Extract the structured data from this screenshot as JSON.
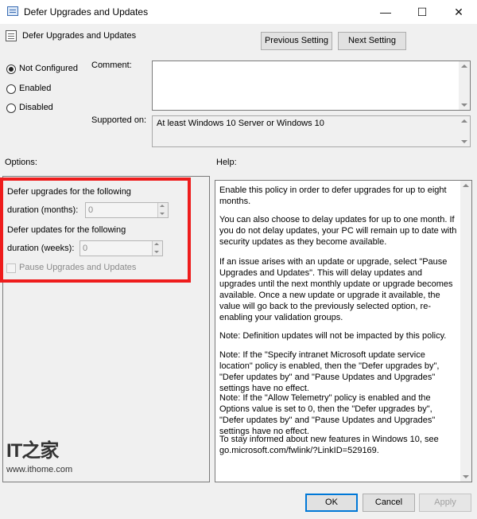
{
  "window": {
    "title": "Defer Upgrades and Updates",
    "minimize_glyph": "—",
    "maximize_glyph": "☐",
    "close_glyph": "✕"
  },
  "header": {
    "policy_title": "Defer Upgrades and Updates",
    "previous_setting": "Previous Setting",
    "next_setting": "Next Setting"
  },
  "state": {
    "selected": "not_configured",
    "options": [
      {
        "id": "not_configured",
        "label": "Not Configured"
      },
      {
        "id": "enabled",
        "label": "Enabled"
      },
      {
        "id": "disabled",
        "label": "Disabled"
      }
    ]
  },
  "comment": {
    "label": "Comment:",
    "value": ""
  },
  "supported": {
    "label": "Supported on:",
    "value": "At least Windows 10 Server or Windows 10"
  },
  "options_section": {
    "label": "Options:",
    "upgrades_line1": "Defer upgrades for the following",
    "upgrades_line2": "duration (months):",
    "upgrades_value": "0",
    "updates_line1": "Defer updates for the following",
    "updates_line2": "duration (weeks):",
    "updates_value": "0",
    "pause_label": "Pause Upgrades and Updates"
  },
  "help": {
    "label": "Help:",
    "paragraphs": [
      "Enable this policy in order to defer upgrades for up to eight months.",
      "You can also choose to delay updates for up to one month. If you do not delay updates, your PC will remain up to date with security updates as they become available.",
      "If an issue arises with an update or upgrade, select \"Pause Upgrades and Updates\". This will delay updates and upgrades until the next monthly update or upgrade becomes available. Once a new update or upgrade it available, the value will go back to the previously selected option, re-enabling your validation groups.",
      "Note: Definition updates will not be impacted by this policy.",
      "Note: If the \"Specify intranet Microsoft update service location\" policy is enabled, then the \"Defer upgrades by\", \"Defer updates by\" and \"Pause Updates and Upgrades\" settings have no effect.",
      "Note: If the \"Allow Telemetry\" policy is enabled and the Options value is set to 0, then the \"Defer upgrades by\", \"Defer updates by\" and \"Pause Updates and Upgrades\" settings have no effect.",
      "To stay informed about new features in Windows 10, see go.microsoft.com/fwlink/?LinkID=529169."
    ]
  },
  "footer": {
    "ok": "OK",
    "cancel": "Cancel",
    "apply": "Apply"
  },
  "watermark": {
    "logo": "IT之家",
    "url": "www.ithome.com"
  },
  "colors": {
    "highlight": "#ee1c1c",
    "focus_blue": "#0078d7"
  }
}
